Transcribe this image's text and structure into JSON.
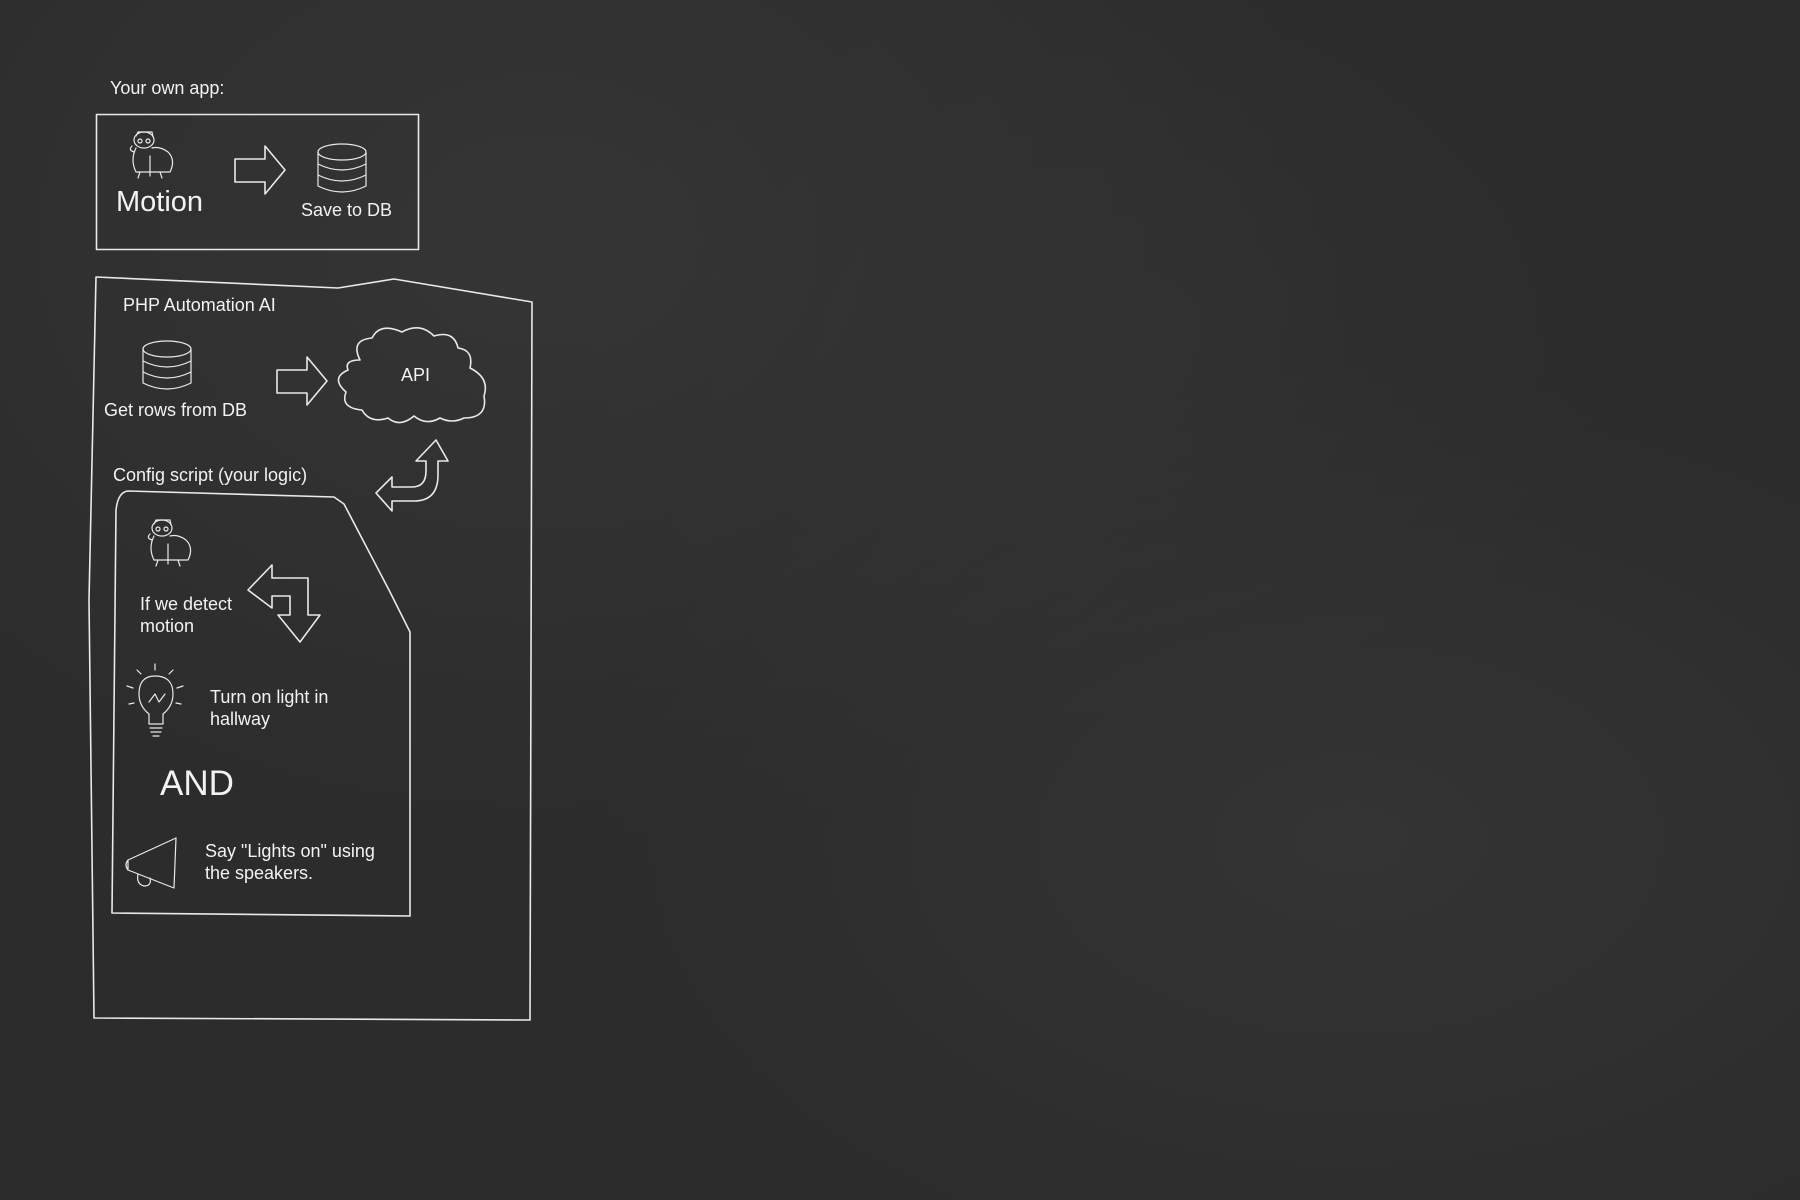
{
  "app_section": {
    "heading": "Your own app:",
    "motion_label": "Motion",
    "save_label": "Save to DB"
  },
  "automation_section": {
    "heading": "PHP Automation AI",
    "get_rows_label": "Get rows from DB",
    "api_label": "API",
    "config_heading": "Config script (your logic)",
    "config": {
      "detect_line1": "If we detect",
      "detect_line2": "motion",
      "light_line1": "Turn on light in",
      "light_line2": "hallway",
      "and_label": "AND",
      "say_line1": "Say \"Lights on\" using",
      "say_line2": "the speakers."
    }
  },
  "icons": [
    "motion-character-icon",
    "right-arrow-icon",
    "database-icon",
    "cloud-icon",
    "return-arrow-icon",
    "turn-arrow-icon",
    "lightbulb-icon",
    "megaphone-icon"
  ]
}
